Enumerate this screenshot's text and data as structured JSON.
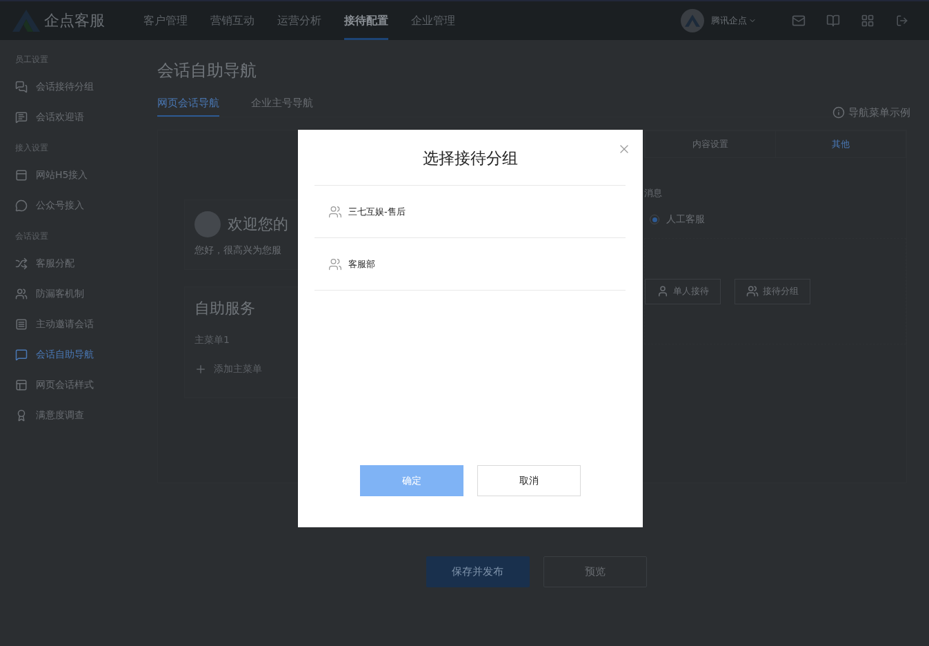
{
  "top_bar": {
    "logo": "企点客服",
    "nav": [
      {
        "label": "客户管理",
        "selected": false
      },
      {
        "label": "营销互动",
        "selected": false
      },
      {
        "label": "运营分析",
        "selected": false
      },
      {
        "label": "接待配置",
        "selected": true
      },
      {
        "label": "企业管理",
        "selected": false
      }
    ],
    "account": "腾讯企点"
  },
  "sidebar": {
    "sections": [
      {
        "title": "员工设置",
        "items": [
          {
            "label": "会话接待分组",
            "selected": false
          },
          {
            "label": "会话欢迎语",
            "selected": false
          }
        ]
      },
      {
        "title": "接入设置",
        "items": [
          {
            "label": "网站H5接入",
            "selected": false
          },
          {
            "label": "公众号接入",
            "selected": false
          }
        ]
      },
      {
        "title": "会话设置",
        "items": [
          {
            "label": "客服分配",
            "selected": false
          },
          {
            "label": "防漏客机制",
            "selected": false
          },
          {
            "label": "主动邀请会话",
            "selected": false
          },
          {
            "label": "会话自助导航",
            "selected": true
          },
          {
            "label": "网页会话样式",
            "selected": false
          },
          {
            "label": "满意度调查",
            "selected": false
          }
        ]
      }
    ]
  },
  "page": {
    "title": "会话自助导航",
    "tabs": [
      {
        "label": "网页会话导航",
        "selected": true
      },
      {
        "label": "企业主号导航",
        "selected": false
      }
    ],
    "preview": {
      "welcome_title": "欢迎您的",
      "welcome_text": "您好，很高兴为您服",
      "self_service_title": "自助服务",
      "menu_item": "主菜单1",
      "add_menu": "添加主菜单"
    },
    "example_link": "导航菜单示例",
    "settings_tabs": [
      {
        "label": "内容设置",
        "selected": false
      },
      {
        "label": "其他",
        "selected": true
      }
    ],
    "field_label": "消息",
    "radio": {
      "label": "人工客服",
      "selected": true
    },
    "reception_buttons": [
      "单人接待",
      "接待分组"
    ],
    "footer_buttons": [
      {
        "label": "保存并发布",
        "kind": "primary"
      },
      {
        "label": "预览",
        "kind": "secondary"
      }
    ]
  },
  "dialog": {
    "title": "选择接待分组",
    "groups": [
      "三七互娱-售后",
      "客服部"
    ],
    "buttons": [
      {
        "label": "确定",
        "kind": "primary"
      },
      {
        "label": "取消",
        "kind": "secondary"
      }
    ]
  }
}
